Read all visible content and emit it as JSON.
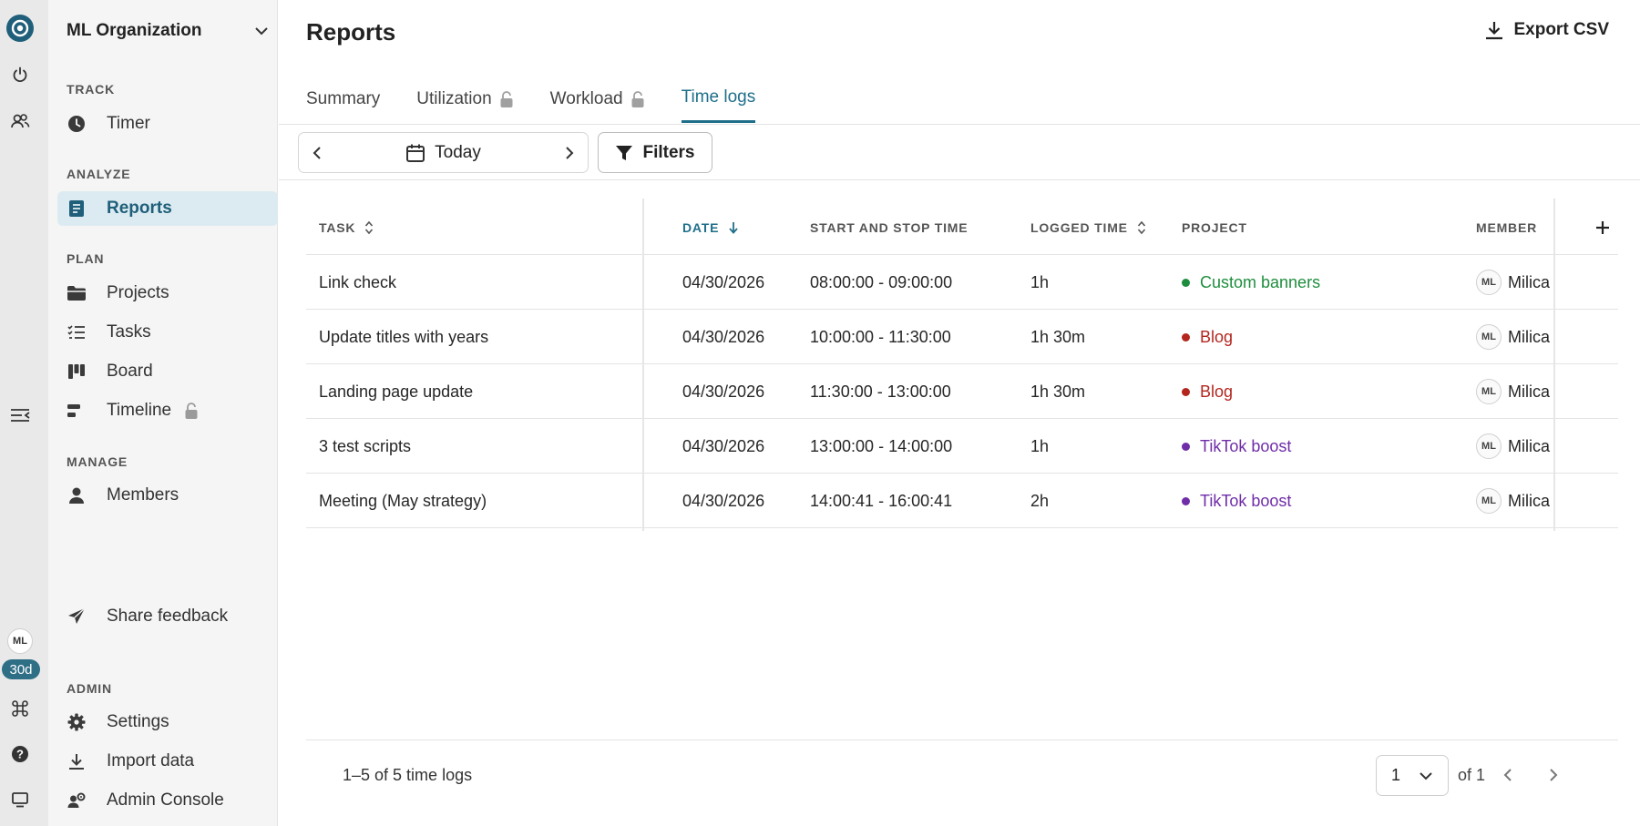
{
  "rail": {
    "trial_badge": "30d",
    "avatar_initials": "ML"
  },
  "sidebar": {
    "org_name": "ML Organization",
    "sections": {
      "track": "TRACK",
      "analyze": "ANALYZE",
      "plan": "PLAN",
      "manage": "MANAGE",
      "admin": "ADMIN"
    },
    "items": {
      "timer": "Timer",
      "reports": "Reports",
      "projects": "Projects",
      "tasks": "Tasks",
      "board": "Board",
      "timeline": "Timeline",
      "members": "Members",
      "feedback": "Share feedback",
      "settings": "Settings",
      "import": "Import data",
      "admin_console": "Admin Console"
    }
  },
  "header": {
    "title": "Reports",
    "export_label": "Export CSV"
  },
  "tabs": {
    "summary": "Summary",
    "utilization": "Utilization",
    "workload": "Workload",
    "time_logs": "Time logs",
    "active": "time_logs"
  },
  "toolbar": {
    "date_label": "Today",
    "filters_label": "Filters"
  },
  "table": {
    "columns": {
      "task": "Task",
      "date": "Date",
      "start_stop": "Start and stop time",
      "logged": "Logged time",
      "project": "Project",
      "member": "Member"
    },
    "rows": [
      {
        "task": "Link check",
        "date": "04/30/2026",
        "time": "08:00:00 - 09:00:00",
        "logged": "1h",
        "project": "Custom banners",
        "project_color": "#1e8e3e",
        "member_initials": "ML",
        "member": "Milica"
      },
      {
        "task": "Update titles with years",
        "date": "04/30/2026",
        "time": "10:00:00 - 11:30:00",
        "logged": "1h 30m",
        "project": "Blog",
        "project_color": "#b3261e",
        "member_initials": "ML",
        "member": "Milica"
      },
      {
        "task": "Landing page update",
        "date": "04/30/2026",
        "time": "11:30:00 - 13:00:00",
        "logged": "1h 30m",
        "project": "Blog",
        "project_color": "#b3261e",
        "member_initials": "ML",
        "member": "Milica"
      },
      {
        "task": "3 test scripts",
        "date": "04/30/2026",
        "time": "13:00:00 - 14:00:00",
        "logged": "1h",
        "project": "TikTok boost",
        "project_color": "#6f2da8",
        "member_initials": "ML",
        "member": "Milica"
      },
      {
        "task": "Meeting (May strategy)",
        "date": "04/30/2026",
        "time": "14:00:41 - 16:00:41",
        "logged": "2h",
        "project": "TikTok boost",
        "project_color": "#6f2da8",
        "member_initials": "ML",
        "member": "Milica"
      }
    ]
  },
  "footer": {
    "count_text": "1–5 of 5 time logs",
    "page_value": "1",
    "page_of": "of 1"
  }
}
